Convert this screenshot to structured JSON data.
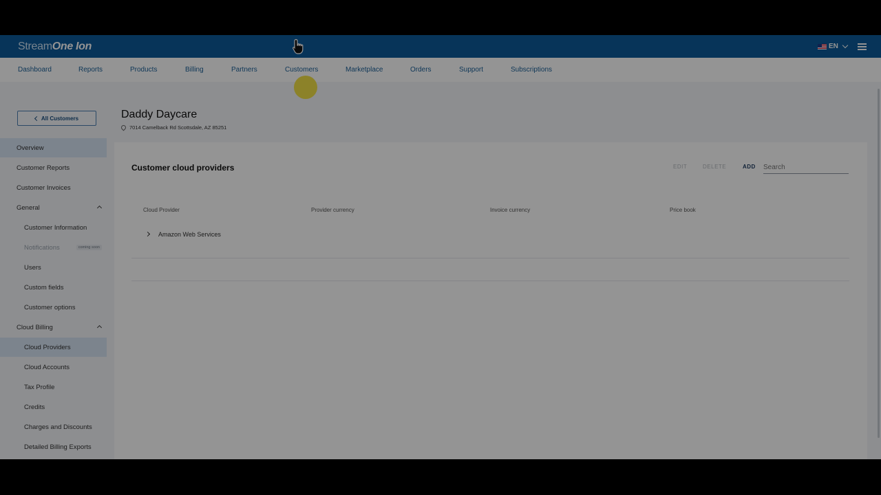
{
  "brand": {
    "part1": "Stream",
    "part2": "One",
    "part3": "Ion"
  },
  "header": {
    "lang": "EN"
  },
  "nav": [
    "Dashboard",
    "Reports",
    "Products",
    "Billing",
    "Partners",
    "Customers",
    "Marketplace",
    "Orders",
    "Support",
    "Subscriptions"
  ],
  "sidebar": {
    "back_label": "All Customers",
    "overview": "Overview",
    "customer_reports": "Customer Reports",
    "customer_invoices": "Customer Invoices",
    "general": "General",
    "customer_information": "Customer Information",
    "notifications": "Notifications",
    "coming_soon": "coming soon",
    "users": "Users",
    "custom_fields": "Custom fields",
    "customer_options": "Customer options",
    "cloud_billing": "Cloud Billing",
    "cloud_providers": "Cloud Providers",
    "cloud_accounts": "Cloud Accounts",
    "tax_profile": "Tax Profile",
    "credits": "Credits",
    "charges_discounts": "Charges and Discounts",
    "billing_exports": "Detailed Billing Exports"
  },
  "customer": {
    "name": "Daddy Daycare",
    "address": "7014 Camelback Rd Scottsdale, AZ 85251"
  },
  "panel": {
    "title": "Customer cloud providers",
    "edit": "EDIT",
    "delete": "DELETE",
    "add": "ADD",
    "search_placeholder": "Search",
    "columns": [
      "Cloud Provider",
      "Provider currency",
      "Invoice currency",
      "Price book"
    ],
    "rows": [
      "Amazon Web Services"
    ]
  }
}
